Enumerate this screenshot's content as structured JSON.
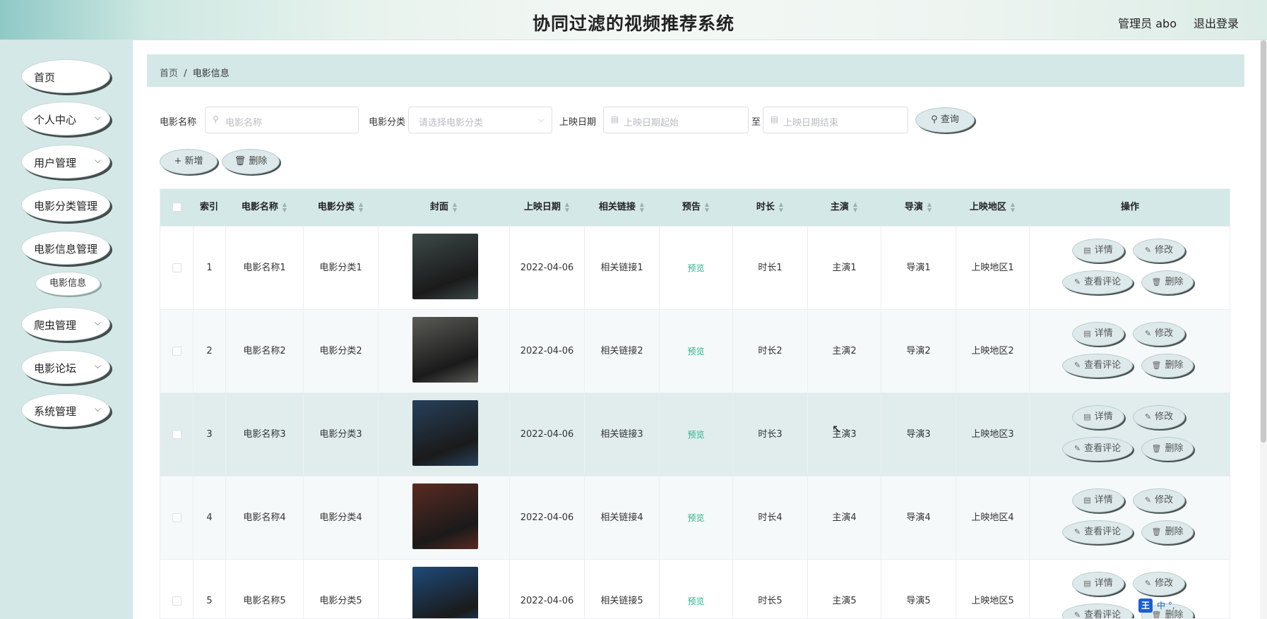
{
  "header": {
    "title": "协同过滤的视频推荐系统",
    "admin": "管理员 abo",
    "logout": "退出登录"
  },
  "sidebar": {
    "items": [
      {
        "label": "首页",
        "chevron": false
      },
      {
        "label": "个人中心",
        "chevron": true
      },
      {
        "label": "用户管理",
        "chevron": true
      },
      {
        "label": "电影分类管理",
        "chevron": false
      },
      {
        "label": "电影信息管理",
        "chevron": false
      },
      {
        "label": "爬虫管理",
        "chevron": true
      },
      {
        "label": "电影论坛",
        "chevron": true
      },
      {
        "label": "系统管理",
        "chevron": true
      }
    ],
    "submenu": {
      "label": "电影信息"
    }
  },
  "breadcrumb": {
    "home": "首页",
    "separator": "/",
    "current": "电影信息"
  },
  "search": {
    "name_label": "电影名称",
    "name_placeholder": "电影名称",
    "category_label": "电影分类",
    "category_placeholder": "请选择电影分类",
    "date_label": "上映日期",
    "date_start_placeholder": "上映日期起始",
    "date_to": "至",
    "date_end_placeholder": "上映日期结束",
    "query_button": "查询"
  },
  "actions": {
    "add": "新增",
    "delete": "删除"
  },
  "table": {
    "headers": [
      "索引",
      "电影名称",
      "电影分类",
      "封面",
      "上映日期",
      "相关链接",
      "预告",
      "时长",
      "主演",
      "导演",
      "上映地区",
      "操作"
    ],
    "rows": [
      {
        "index": "1",
        "name": "电影名称1",
        "category": "电影分类1",
        "date": "2022-04-06",
        "link": "相关链接1",
        "trailer": "预览",
        "duration": "时长1",
        "actor": "主演1",
        "director": "导演1",
        "region": "上映地区1",
        "poster_color": "#3c4a48"
      },
      {
        "index": "2",
        "name": "电影名称2",
        "category": "电影分类2",
        "date": "2022-04-06",
        "link": "相关链接2",
        "trailer": "预览",
        "duration": "时长2",
        "actor": "主演2",
        "director": "导演2",
        "region": "上映地区2",
        "poster_color": "#5a5a56"
      },
      {
        "index": "3",
        "name": "电影名称3",
        "category": "电影分类3",
        "date": "2022-04-06",
        "link": "相关链接3",
        "trailer": "预览",
        "duration": "时长3",
        "actor": "主演3",
        "director": "导演3",
        "region": "上映地区3",
        "poster_color": "#27405a"
      },
      {
        "index": "4",
        "name": "电影名称4",
        "category": "电影分类4",
        "date": "2022-04-06",
        "link": "相关链接4",
        "trailer": "预览",
        "duration": "时长4",
        "actor": "主演4",
        "director": "导演4",
        "region": "上映地区4",
        "poster_color": "#5a2a22"
      },
      {
        "index": "5",
        "name": "电影名称5",
        "category": "电影分类5",
        "date": "2022-04-06",
        "link": "相关链接5",
        "trailer": "预览",
        "duration": "时长5",
        "actor": "主演5",
        "director": "导演5",
        "region": "上映地区5",
        "poster_color": "#1e4a7a"
      }
    ],
    "row_actions": {
      "detail": "详情",
      "edit": "修改",
      "comments": "查看评论",
      "delete": "删除"
    }
  },
  "ime": {
    "badge": "王",
    "text": "中 °,"
  }
}
